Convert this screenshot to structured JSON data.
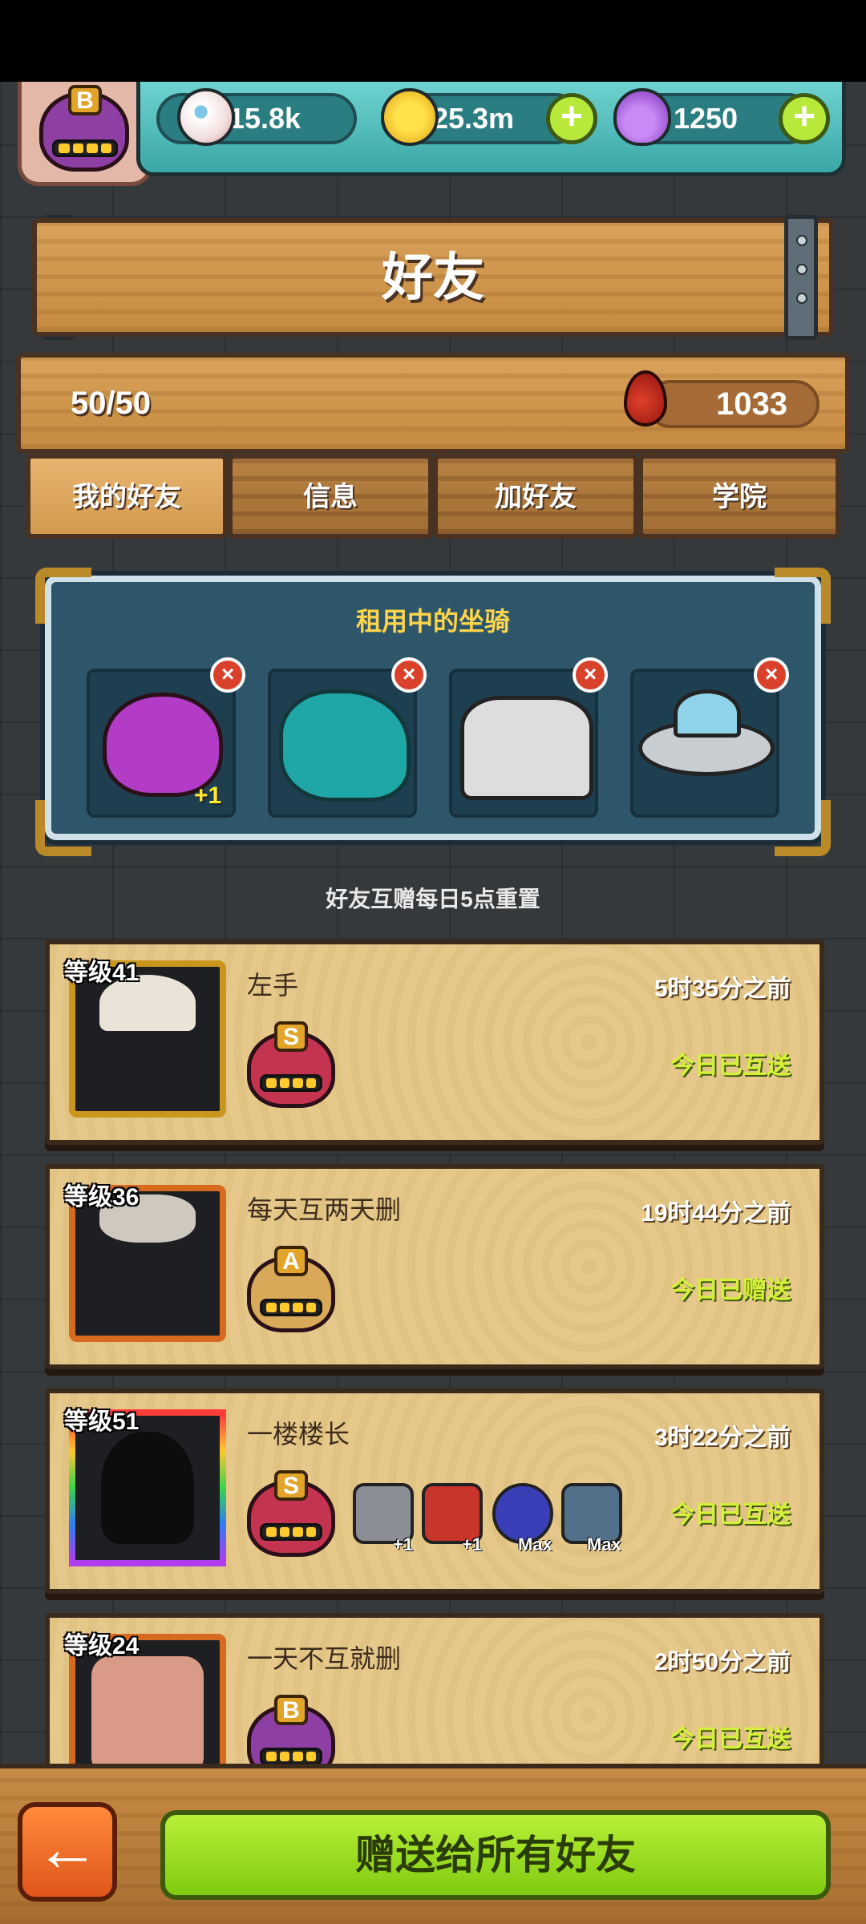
{
  "resources": {
    "eyes": "15.8k",
    "coins": "25.3m",
    "potions": "1250"
  },
  "player": {
    "rank": "B"
  },
  "page": {
    "title": "好友"
  },
  "capacity": {
    "count": "50/50",
    "blood": "1033"
  },
  "tabs": [
    {
      "label": "我的好友",
      "active": true
    },
    {
      "label": "信息"
    },
    {
      "label": "加好友"
    },
    {
      "label": "学院"
    }
  ],
  "rented_mounts": {
    "title": "租用中的坐骑",
    "mounts": [
      {
        "name": "purple-monster",
        "badge": "+1"
      },
      {
        "name": "dragon",
        "badge": ""
      },
      {
        "name": "satellite-tank",
        "badge": ""
      },
      {
        "name": "ufo",
        "badge": ""
      }
    ],
    "close": "×"
  },
  "reset_note": "好友互赠每日5点重置",
  "friends": [
    {
      "level": "等级41",
      "name": "左手",
      "time": "5时35分之前",
      "status": "今日已互送",
      "rank": "S",
      "mounts": []
    },
    {
      "level": "等级36",
      "name": "每天互两天删",
      "time": "19时44分之前",
      "status": "今日已赠送",
      "rank": "A",
      "mounts": []
    },
    {
      "level": "等级51",
      "name": "一楼楼长",
      "time": "3时22分之前",
      "status": "今日已互送",
      "rank": "S",
      "mounts": [
        {
          "label": "+1"
        },
        {
          "label": "+1"
        },
        {
          "label": "Max"
        },
        {
          "label": "Max"
        }
      ]
    },
    {
      "level": "等级24",
      "name": "一天不互就删",
      "time": "2时50分之前",
      "status": "今日已互送",
      "rank": "B",
      "mounts": []
    }
  ],
  "bottom": {
    "gift_all": "赠送给所有好友",
    "back": "←"
  }
}
